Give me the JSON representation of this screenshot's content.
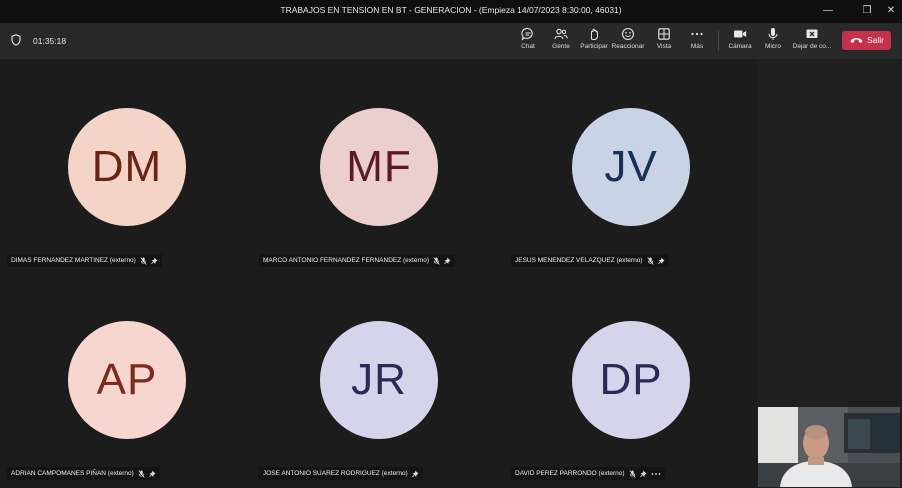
{
  "window": {
    "title": "TRABAJOS EN TENSION EN BT - GENERACION - (Empieza 14/07/2023 8:30:00, 46031)",
    "minimize": "—",
    "maximize": "❐",
    "close": "✕"
  },
  "toolbar": {
    "timer": "01:35:18",
    "tools": [
      {
        "label": "Chat",
        "icon": "chat-icon"
      },
      {
        "label": "Gente",
        "icon": "people-icon"
      },
      {
        "label": "Participar",
        "icon": "participate-icon"
      },
      {
        "label": "Reaccionar",
        "icon": "smile-icon"
      },
      {
        "label": "Vista",
        "icon": "grid-icon"
      },
      {
        "label": "Más",
        "icon": "more-icon"
      },
      {
        "label": "Cámara",
        "icon": "camera-icon"
      },
      {
        "label": "Micro",
        "icon": "mic-icon"
      },
      {
        "label": "Dejar de co...",
        "icon": "stop-share-icon"
      }
    ],
    "leave_label": "Salir"
  },
  "participants": [
    {
      "initials": "DM",
      "name": "DIMAS FERNANDEZ MARTINEZ (externo)",
      "bg": "#f5d4c8",
      "fg": "#6b2316",
      "muted": true,
      "pinned": true,
      "more": false
    },
    {
      "initials": "MF",
      "name": "MARCO ANTONIO FERNANDEZ FERNANDEZ (externo)",
      "bg": "#ebcece",
      "fg": "#5e1a24",
      "muted": true,
      "pinned": true,
      "more": false
    },
    {
      "initials": "JV",
      "name": "JESUS MENENDEZ VELAZQUEZ (externo)",
      "bg": "#c8d4e6",
      "fg": "#1a2f55",
      "muted": true,
      "pinned": true,
      "more": false
    },
    {
      "initials": "AP",
      "name": "ADRIAN CAMPOMANES PIÑAN (externo)",
      "bg": "#f6d6ce",
      "fg": "#7e2a1e",
      "muted": true,
      "pinned": true,
      "more": false
    },
    {
      "initials": "JR",
      "name": "JOSE ANTONIO SUAREZ RODRIGUEZ (externo)",
      "bg": "#d6d4ea",
      "fg": "#2c2858",
      "muted": false,
      "pinned": true,
      "more": false
    },
    {
      "initials": "DP",
      "name": "DAVID PEREZ PARRONDO (externo)",
      "bg": "#d6d4ea",
      "fg": "#2c2858",
      "muted": true,
      "pinned": true,
      "more": true
    }
  ]
}
